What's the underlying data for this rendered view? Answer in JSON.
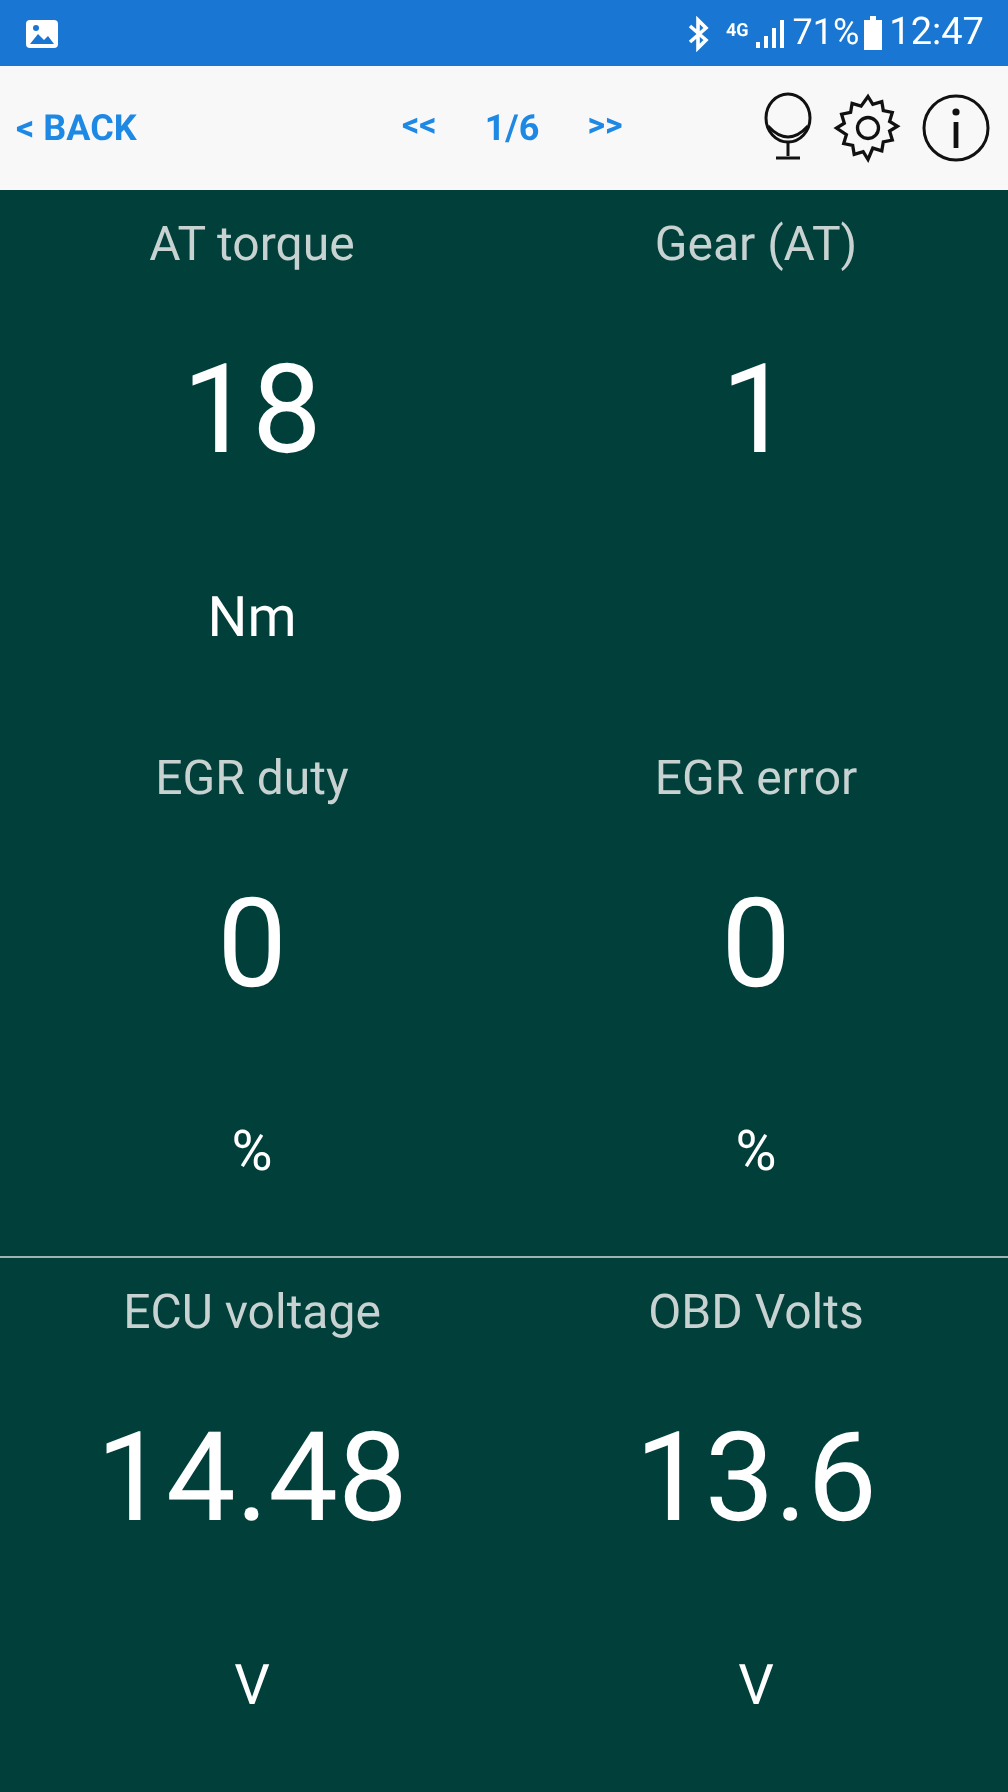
{
  "status_bar": {
    "network": "4G",
    "battery": "71%",
    "time": "12:47"
  },
  "nav": {
    "back": "< BACK",
    "prev": "<<",
    "page": "1/6",
    "next": ">>"
  },
  "gauges": [
    {
      "label": "AT torque",
      "value": "18",
      "unit": "Nm"
    },
    {
      "label": "Gear (AT)",
      "value": "1"
    },
    {
      "label": "EGR duty",
      "value": "0",
      "unit": "%"
    },
    {
      "label": "EGR error",
      "value": "0",
      "unit": "%"
    },
    {
      "label": "ECU voltage",
      "value": "14.48",
      "unit": "V"
    },
    {
      "label": "OBD Volts",
      "value": "13.6",
      "unit": "V"
    }
  ]
}
